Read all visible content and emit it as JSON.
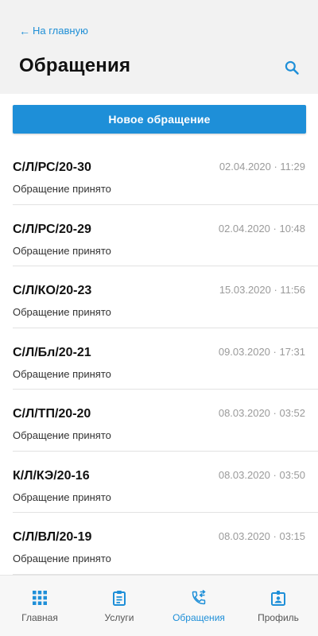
{
  "header": {
    "back_label": "На главную",
    "title": "Обращения"
  },
  "actions": {
    "new_request_label": "Новое обращение"
  },
  "requests": [
    {
      "code": "С/Л/РС/20-30",
      "date": "02.04.2020 · 11:29",
      "status": "Обращение принято"
    },
    {
      "code": "С/Л/РС/20-29",
      "date": "02.04.2020 · 10:48",
      "status": "Обращение принято"
    },
    {
      "code": "С/Л/КО/20-23",
      "date": "15.03.2020 · 11:56",
      "status": "Обращение принято"
    },
    {
      "code": "С/Л/Бл/20-21",
      "date": "09.03.2020 · 17:31",
      "status": "Обращение принято"
    },
    {
      "code": "С/Л/ТП/20-20",
      "date": "08.03.2020 · 03:52",
      "status": "Обращение принято"
    },
    {
      "code": "К/Л/КЭ/20-16",
      "date": "08.03.2020 · 03:50",
      "status": "Обращение принято"
    },
    {
      "code": "С/Л/ВЛ/20-19",
      "date": "08.03.2020 · 03:15",
      "status": "Обращение принято"
    }
  ],
  "bottom_nav": {
    "items": [
      {
        "label": "Главная",
        "icon": "grid-icon"
      },
      {
        "label": "Услуги",
        "icon": "clipboard-icon"
      },
      {
        "label": "Обращения",
        "icon": "phone-transfer-icon",
        "active": true
      },
      {
        "label": "Профиль",
        "icon": "badge-icon"
      }
    ]
  },
  "colors": {
    "accent": "#1e8fd8",
    "header_bg": "#f2f2f2",
    "muted": "#9a9a9a"
  }
}
